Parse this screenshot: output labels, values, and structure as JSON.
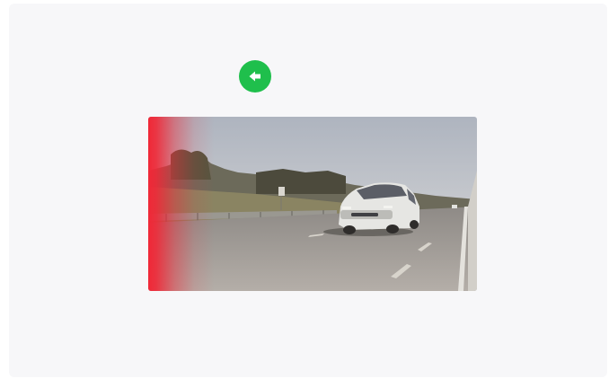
{
  "back_button": {
    "icon": "arrow-left-icon",
    "color": "#1fbf4c"
  },
  "photo": {
    "description_icon": "road-photo",
    "overlay_color": "#f02837"
  }
}
